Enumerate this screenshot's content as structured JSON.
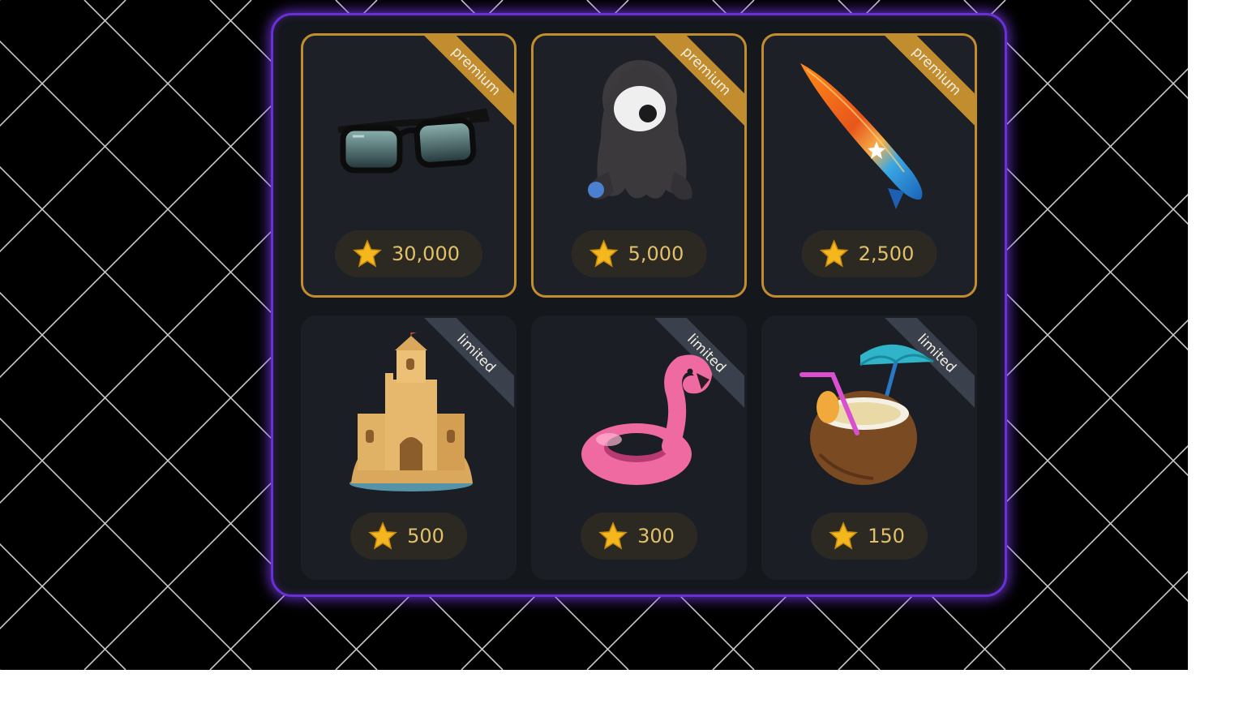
{
  "colors": {
    "panel_glow": "#6a2fd6",
    "premium_accent": "#c28d2f",
    "limited_accent": "#3a414d",
    "price_text": "#e2c06a"
  },
  "items": [
    {
      "name": "sunglasses",
      "icon": "sunglasses-icon",
      "ribbon": "premium",
      "price": "30,000"
    },
    {
      "name": "hooded-plush",
      "icon": "hooded-plush-icon",
      "ribbon": "premium",
      "price": "5,000"
    },
    {
      "name": "surfboard",
      "icon": "surfboard-icon",
      "ribbon": "premium",
      "price": "2,500"
    },
    {
      "name": "sandcastle",
      "icon": "sandcastle-icon",
      "ribbon": "limited",
      "price": "500"
    },
    {
      "name": "flamingo-float",
      "icon": "flamingo-float-icon",
      "ribbon": "limited",
      "price": "300"
    },
    {
      "name": "coconut-drink",
      "icon": "coconut-drink-icon",
      "ribbon": "limited",
      "price": "150"
    }
  ]
}
